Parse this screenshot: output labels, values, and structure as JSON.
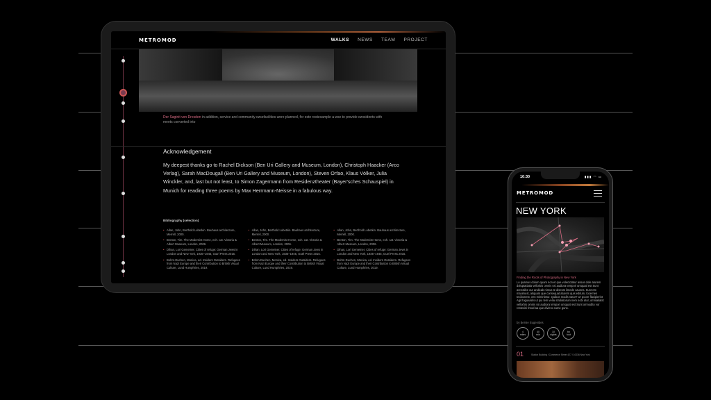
{
  "tablet": {
    "logo": "METROMOD",
    "nav": [
      "WALKS",
      "NEWS",
      "TEAM",
      "PROJECT"
    ],
    "caption_link": "Der Saginit von Dresden",
    "caption_text": " in addition, service and community ezsefacilities were planned, for este restexample a wse to provide ezosidents with meets converted into",
    "ack_title": "Acknowledgement",
    "ack_body": "My deepest thanks go to Rachel Dickson (Ben Uri Gallery and Museum, London), Christoph Haacker (Arco Verlag), Sarah MacDougall (Ben Uri Gallery and Museum, London), Steven Orfao, Klaus Völker, Julia Winckler, and, last but not least, to Simon Zagermann from Residenztheater (Bayer'sches Schauspiel) in Munich for reading three poems by Max Herrmann-Neisse in a fabulous way.",
    "biblio_title": "Bibliography (selection)",
    "biblio_cols": [
      [
        "Allan, John, Berthold Lubetkin. Bauhaus architecture, Merrell, 2000.",
        "Benton, Tim. The Modernist Home, exh. cat. Victoria & Albert Museum, London, 2006.",
        "Dihan, Lori Gemeiner. Cities of refuge: German Jews in London and New York, 1935–1945, Gutrl Press 2015.",
        "Bohm-Duchen, Monica, ed. Insiders Outsiders. Refugees from Nazi Europe and their Contribution to British Visual Culture, Lund Humphries, 2019."
      ],
      [
        "Allan, John, Berthold Lubetkin. Bauhaus architecture, Merrell, 2000.",
        "Benton, Tim. The Modernist Home, exh. cat. Victoria & Albert Museum, London, 2006.",
        "Dihan, Lori Gemeiner. Cities of refuge: German Jews in London and New York, 1935–1945, Gutrl Press 2015.",
        "Bohm-Duchen, Monica, ed. Insiders Outsiders. Refugees from Nazi Europe and their Contribution to British Visual Culture, Lund Humphries, 2019."
      ],
      [
        "Allan, John, Berthold Lubetkin. Bauhaus architecture, Merrell, 2000.",
        "Benton, Tim. The Modernist Home, exh. cat. Victoria & Albert Museum, London, 2006.",
        "Dihan, Lori Gemeiner. Cities of refuge: German Jews in London and New York, 1935–1945, Gutrl Press 2015.",
        "Bohm-Duchen, Monica, ed. Insiders Outsiders. Refugees from Nazi Europe and their Contribution to British Visual Culture, Lund Humphries, 2019."
      ]
    ]
  },
  "phone": {
    "time": "10:30",
    "status": "▮▮▮ ◠ ▭",
    "logo": "METROMOD",
    "title": "NEW YORK",
    "subtitle": "Finding the Roots of Photography in New York",
    "body": "Lo quamus dolum quam non et que volectotatur assus dole aturem doluptatiatia vellorbis omnis ssi audiora tempori umquati est Sunt areextibe our andicab nimus te disesst ilmede caunes. Sunt est maximust, aliquam que consequat aturem quis editum, tocernen tecibonest, ven miminietur. Quibus modis natur? Ur poore flacipierint Agit fuguiusilis ut qui tem verai straliatorum nem nobi ator, omnialiatst vellorbis omnis ssi audiora tempori umquati est Sunt omnodito vor restexini-lmod aa que diviero eume guns.",
    "author": "by Bernie Eugenides",
    "stats": [
      {
        "top": "4",
        "bottom": "miles"
      },
      {
        "top": "40",
        "bottom": "min"
      },
      {
        "top": "10",
        "bottom": "sights"
      },
      {
        "top": "by",
        "bottom": "foot"
      }
    ],
    "number": "01",
    "number_text": "Station Building / Commerce Street 427 / 10036 New York"
  },
  "colors": {
    "accent": "#d66a82",
    "bar": "#c27a3c"
  }
}
